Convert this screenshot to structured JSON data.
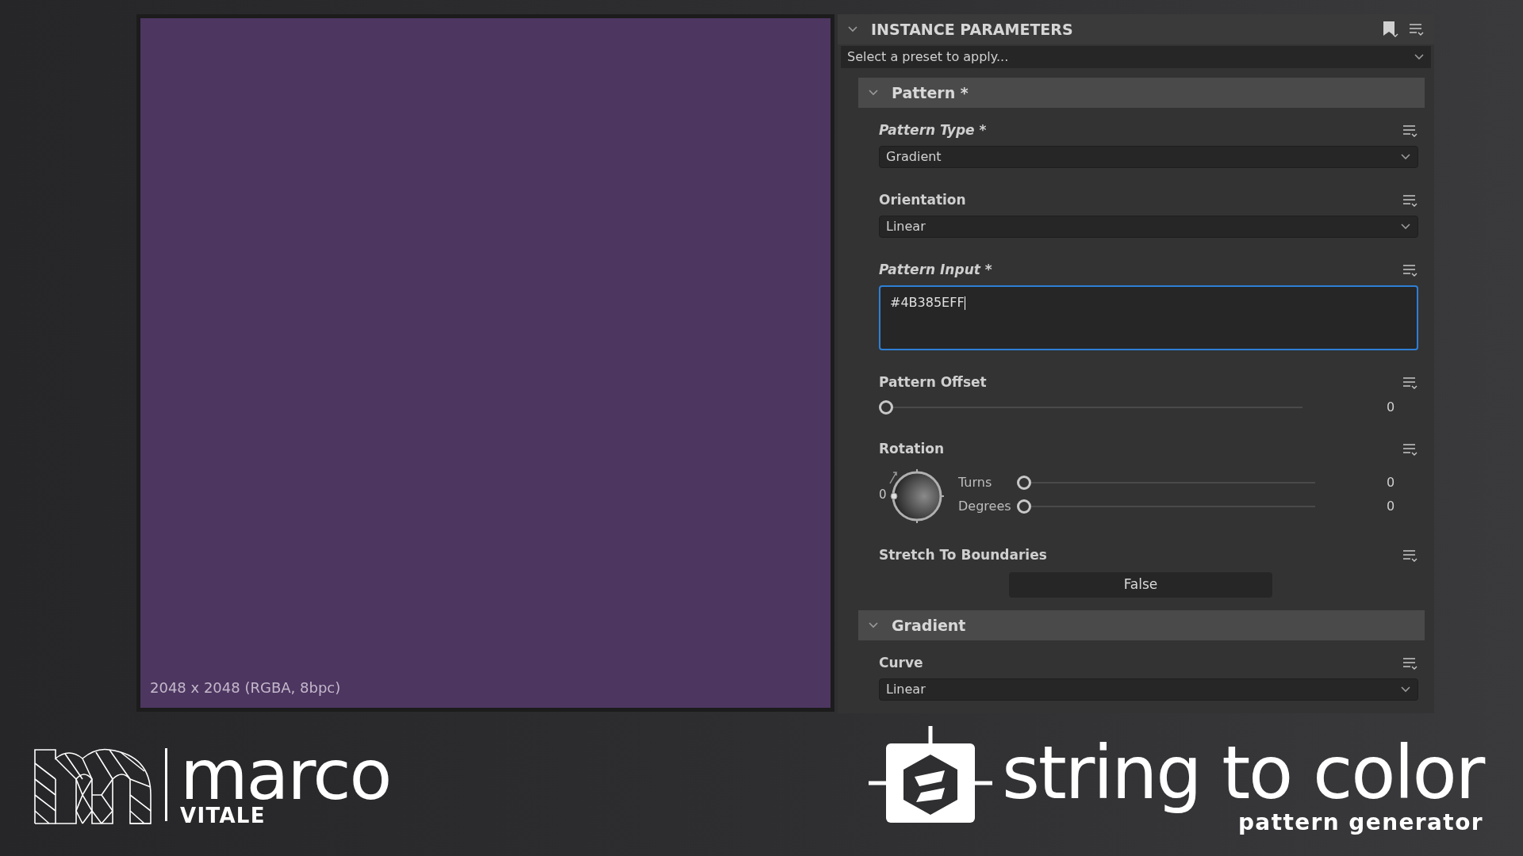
{
  "viewer": {
    "info": "2048 x 2048 (RGBA, 8bpc)"
  },
  "panel": {
    "title": "INSTANCE PARAMETERS",
    "expanded": true,
    "preset": {
      "value": "Select a preset to apply..."
    },
    "groups": [
      {
        "title": "Pattern *",
        "expanded": true,
        "params": [
          {
            "kind": "dropdown",
            "label": "Pattern Type *",
            "modified": true,
            "value": "Gradient"
          },
          {
            "kind": "dropdown",
            "label": "Orientation",
            "modified": false,
            "value": "Linear"
          },
          {
            "kind": "textbox",
            "label": "Pattern Input *",
            "modified": true,
            "value": "#4B385EFF",
            "focused": true
          },
          {
            "kind": "slider",
            "label": "Pattern Offset",
            "modified": false,
            "level": 0,
            "reading": "0"
          },
          {
            "kind": "rotation",
            "label": "Rotation",
            "modified": false,
            "angle": "0",
            "sliders": [
              {
                "label": "Turns",
                "level": 0,
                "reading": "0"
              },
              {
                "label": "Degrees",
                "level": 0,
                "reading": "0"
              }
            ]
          },
          {
            "kind": "toggle",
            "label": "Stretch To Boundaries",
            "modified": false,
            "value": "False"
          }
        ]
      },
      {
        "title": "Gradient",
        "expanded": true,
        "params": [
          {
            "kind": "dropdown",
            "label": "Curve",
            "modified": false,
            "value": "Linear"
          }
        ]
      }
    ]
  },
  "branding": {
    "author": {
      "name": "marco",
      "surname": "VITALE"
    },
    "product": {
      "name": "string to color",
      "tagline": "pattern generator"
    }
  }
}
